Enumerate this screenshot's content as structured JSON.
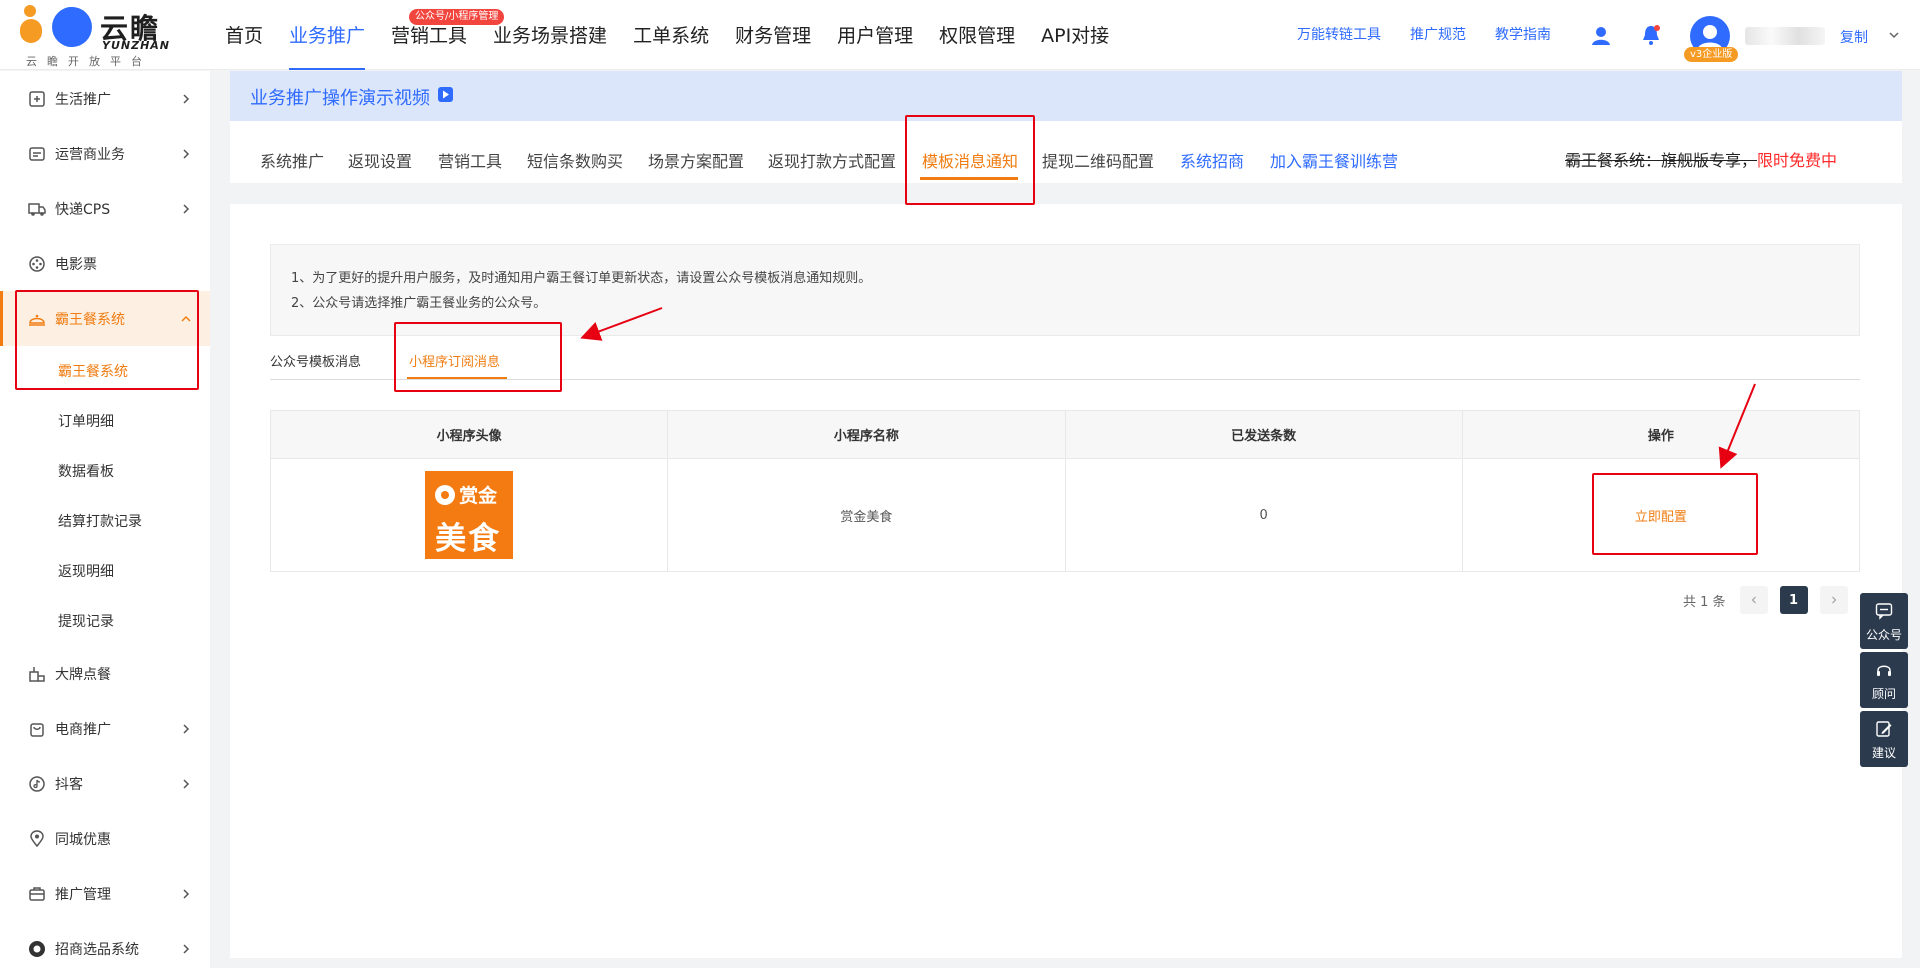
{
  "brand": {
    "name": "云瞻",
    "name_en": "YUNZHAN",
    "slogan": "云瞻开放平台"
  },
  "nav": {
    "items": [
      {
        "label": "首页"
      },
      {
        "label": "业务推广"
      },
      {
        "label": "营销工具",
        "badge": "公众号/小程序管理"
      },
      {
        "label": "业务场景搭建"
      },
      {
        "label": "工单系统"
      },
      {
        "label": "财务管理"
      },
      {
        "label": "用户管理"
      },
      {
        "label": "权限管理"
      },
      {
        "label": "API对接"
      }
    ],
    "active_index": 1
  },
  "header": {
    "links": [
      "万能转链工具",
      "推广规范",
      "教学指南"
    ],
    "avatar_badge": "v3企业版",
    "copy_label": "复制"
  },
  "sidebar": {
    "items": [
      {
        "label": "生活推广",
        "icon": "life-promo-icon"
      },
      {
        "label": "运营商业务",
        "icon": "carrier-icon"
      },
      {
        "label": "快递CPS",
        "icon": "truck-icon"
      },
      {
        "label": "电影票",
        "icon": "film-icon"
      },
      {
        "label": "霸王餐系统",
        "icon": "dish-cover-icon"
      },
      {
        "label": "大牌点餐",
        "icon": "food-icon"
      },
      {
        "label": "电商推广",
        "icon": "shopping-bag-icon"
      },
      {
        "label": "抖客",
        "icon": "tiktok-icon"
      },
      {
        "label": "同城优惠",
        "icon": "location-icon"
      },
      {
        "label": "推广管理",
        "icon": "briefcase-icon"
      },
      {
        "label": "招商选品系统",
        "icon": "selection-icon"
      }
    ],
    "sub_items": [
      "霸王餐系统",
      "订单明细",
      "数据看板",
      "结算打款记录",
      "返现明细",
      "提现记录"
    ]
  },
  "banner": {
    "text": "业务推广操作演示视频"
  },
  "subtabs": {
    "items": [
      "系统推广",
      "返现设置",
      "营销工具",
      "短信条数购买",
      "场景方案配置",
      "返现打款方式配置",
      "模板消息通知",
      "提现二维码配置",
      "系统招商",
      "加入霸王餐训练营"
    ],
    "active_index": 6,
    "promo_strike": "霸王餐系统：旗舰版专享，",
    "promo_red": "限时免费中"
  },
  "notice": {
    "line1": "1、为了更好的提升用户服务，及时通知用户霸王餐订单更新状态，请设置公众号模板消息通知规则。",
    "line2": "2、公众号请选择推广霸王餐业务的公众号。"
  },
  "inner_tabs": {
    "items": [
      "公众号模板消息",
      "小程序订阅消息"
    ],
    "active_index": 1
  },
  "table": {
    "headers": [
      "小程序头像",
      "小程序名称",
      "已发送条数",
      "操作"
    ],
    "rows": [
      {
        "logo_top": "赏金",
        "logo_bottom": "美食",
        "name": "赏金美食",
        "sent": "0",
        "action": "立即配置"
      }
    ]
  },
  "pagination": {
    "total": "共 1 条",
    "current": "1"
  },
  "dock": {
    "items": [
      "公众号",
      "顾问",
      "建议"
    ]
  },
  "colors": {
    "primary": "#2f6bff",
    "accent": "#f07c12",
    "annotation": "#e60012"
  }
}
